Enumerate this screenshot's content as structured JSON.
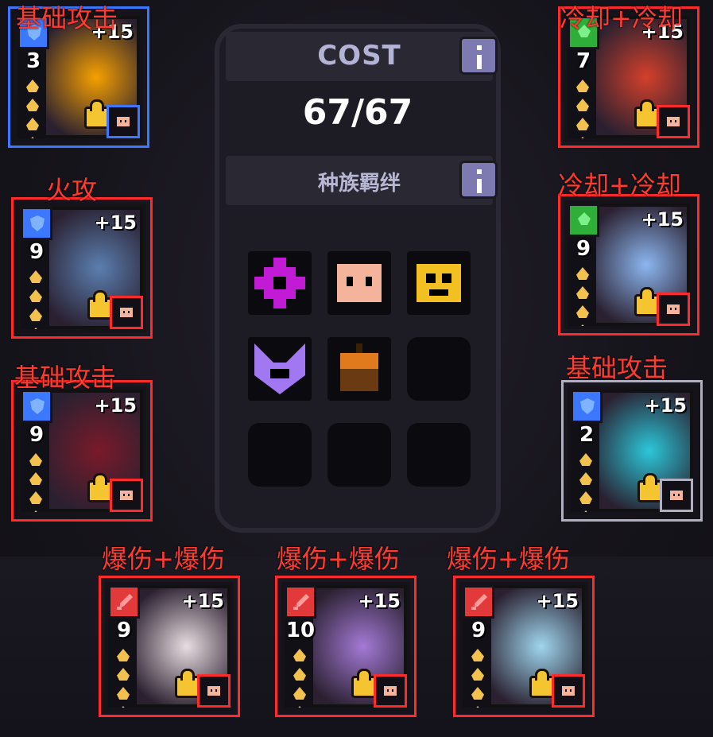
{
  "panel": {
    "cost_title": "COST",
    "cost_value": "67/67",
    "race_title": "种族羁绊",
    "race_slots": [
      {
        "icon": "purple-gear-icon",
        "color": "#c21bd6"
      },
      {
        "icon": "pig-face-icon",
        "color": "#f3b49b"
      },
      {
        "icon": "gold-mask-icon",
        "color": "#f2c021"
      },
      {
        "icon": "purple-horns-icon",
        "color": "#a277f2"
      },
      {
        "icon": "brown-pumpkin-icon",
        "color": "#e07a1c"
      },
      {
        "icon": "empty-slot",
        "color": "#0b0a0e"
      },
      {
        "icon": "empty-slot",
        "color": "#0b0a0e"
      },
      {
        "icon": "empty-slot",
        "color": "#0b0a0e"
      },
      {
        "icon": "empty-slot",
        "color": "#0b0a0e"
      }
    ]
  },
  "cards": [
    {
      "caption": "基础攻击",
      "level": "3",
      "bonus": "+15",
      "badge_color": "#3b78ff",
      "badge_icon": "shield-icon",
      "art": "fire-slime-portrait",
      "art_color": "#f6a000"
    },
    {
      "caption": "火攻",
      "level": "9",
      "bonus": "+15",
      "badge_color": "#3b78ff",
      "badge_icon": "shield-icon",
      "art": "dark-swordsman-portrait",
      "art_color": "#5b7fb0"
    },
    {
      "caption": "基础攻击",
      "level": "9",
      "bonus": "+15",
      "badge_color": "#3b78ff",
      "badge_icon": "shield-icon",
      "art": "vampire-girl-portrait",
      "art_color": "#7a1a2a"
    },
    {
      "caption": "冷却+冷却",
      "level": "7",
      "bonus": "+15",
      "badge_color": "#2fae3a",
      "badge_icon": "leaf-icon",
      "art": "tiger-warrior-portrait",
      "art_color": "#d3402b"
    },
    {
      "caption": "冷却+冷却",
      "level": "9",
      "bonus": "+15",
      "badge_color": "#2fae3a",
      "badge_icon": "leaf-icon",
      "art": "blue-hair-girl-portrait",
      "art_color": "#8cb6f0"
    },
    {
      "caption": "基础攻击",
      "level": "2",
      "bonus": "+15",
      "badge_color": "#3b78ff",
      "badge_icon": "shield-icon",
      "art": "water-slime-portrait",
      "art_color": "#2bc7d9"
    },
    {
      "caption": "爆伤+爆伤",
      "level": "9",
      "bonus": "+15",
      "badge_color": "#e23a3a",
      "badge_icon": "sword-icon",
      "art": "white-hair-girl-portrait",
      "art_color": "#e8dde0"
    },
    {
      "caption": "爆伤+爆伤",
      "level": "10",
      "bonus": "+15",
      "badge_color": "#e23a3a",
      "badge_icon": "sword-icon",
      "art": "witch-girl-portrait",
      "art_color": "#a47ad6"
    },
    {
      "caption": "爆伤+爆伤",
      "level": "9",
      "bonus": "+15",
      "badge_color": "#e23a3a",
      "badge_icon": "sword-icon",
      "art": "ice-girl-portrait",
      "art_color": "#9fd6ee"
    }
  ]
}
